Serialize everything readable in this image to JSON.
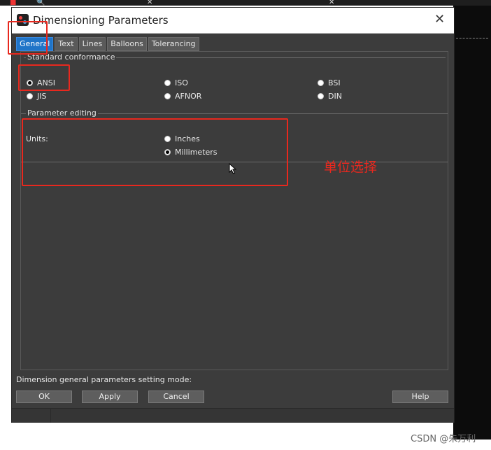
{
  "dialog": {
    "title": "Dimensioning Parameters",
    "tabs": [
      "General",
      "Text",
      "Lines",
      "Balloons",
      "Tolerancing"
    ],
    "active_tab": "General"
  },
  "standard_conformance": {
    "title": "Standard conformance",
    "options": [
      "ANSI",
      "ISO",
      "BSI",
      "JIS",
      "AFNOR",
      "DIN"
    ],
    "selected": "ANSI"
  },
  "parameter_editing": {
    "title": "Parameter editing",
    "units_label": "Units:",
    "units_options": [
      "Inches",
      "Millimeters"
    ],
    "units_selected": "Millimeters"
  },
  "status_text": "Dimension general parameters setting mode:",
  "buttons": {
    "ok": "OK",
    "apply": "Apply",
    "cancel": "Cancel",
    "help": "Help"
  },
  "annotation": {
    "text": "单位选择",
    "color": "#e8281e"
  },
  "watermark": "CSDN @朱万利",
  "colors": {
    "dialog_bg": "#3c3c3c",
    "active_tab": "#1f74c8"
  }
}
